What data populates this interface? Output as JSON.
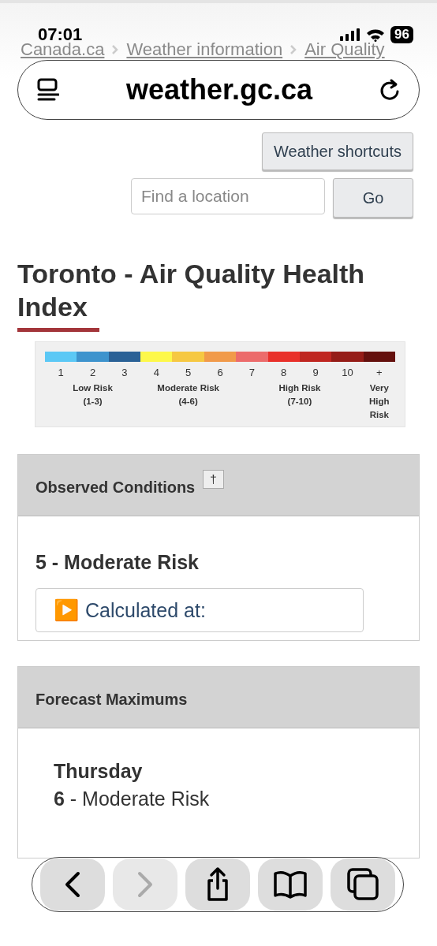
{
  "status_bar": {
    "time": "07:01",
    "battery": "96"
  },
  "breadcrumbs": [
    "Canada.ca",
    "Weather information",
    "Air Quality"
  ],
  "address_bar": {
    "url": "weather.gc.ca"
  },
  "shortcuts_button": "Weather shortcuts",
  "search": {
    "placeholder": "Find a location",
    "button": "Go"
  },
  "title": "Toronto - Air Quality Health Index",
  "scale": {
    "groups": [
      {
        "label": "Low Risk",
        "range": "(1-3)",
        "segments": [
          {
            "label": "1",
            "color": "#5bc8f5"
          },
          {
            "label": "2",
            "color": "#3d93cd"
          },
          {
            "label": "3",
            "color": "#2a6196"
          }
        ]
      },
      {
        "label": "Moderate Risk",
        "range": "(4-6)",
        "segments": [
          {
            "label": "4",
            "color": "#fdf84a"
          },
          {
            "label": "5",
            "color": "#f6c842"
          },
          {
            "label": "6",
            "color": "#f19a4a"
          }
        ]
      },
      {
        "label": "High Risk",
        "range": "(7-10)",
        "segments": [
          {
            "label": "7",
            "color": "#ec6b6b"
          },
          {
            "label": "8",
            "color": "#e9302a"
          },
          {
            "label": "9",
            "color": "#bf2620"
          },
          {
            "label": "10",
            "color": "#951c17"
          }
        ]
      },
      {
        "label": "Very High Risk",
        "segments": [
          {
            "label": "+",
            "color": "#64100d"
          }
        ]
      }
    ]
  },
  "observed": {
    "heading": "Observed Conditions",
    "note_button": "†",
    "value": "5 - Moderate Risk",
    "details": {
      "icon": "▶️",
      "label": "Calculated at:",
      "expanded": false
    }
  },
  "forecast": {
    "heading": "Forecast Maximums",
    "periods": [
      {
        "day": "Thursday",
        "value": "6",
        "risk": " - Moderate Risk"
      }
    ]
  },
  "toolbar": [
    {
      "kind": "back",
      "disabled": false
    },
    {
      "kind": "forward",
      "disabled": true
    },
    {
      "kind": "share",
      "disabled": false
    },
    {
      "kind": "bookmarks",
      "disabled": false
    },
    {
      "kind": "tabs",
      "disabled": false
    }
  ]
}
